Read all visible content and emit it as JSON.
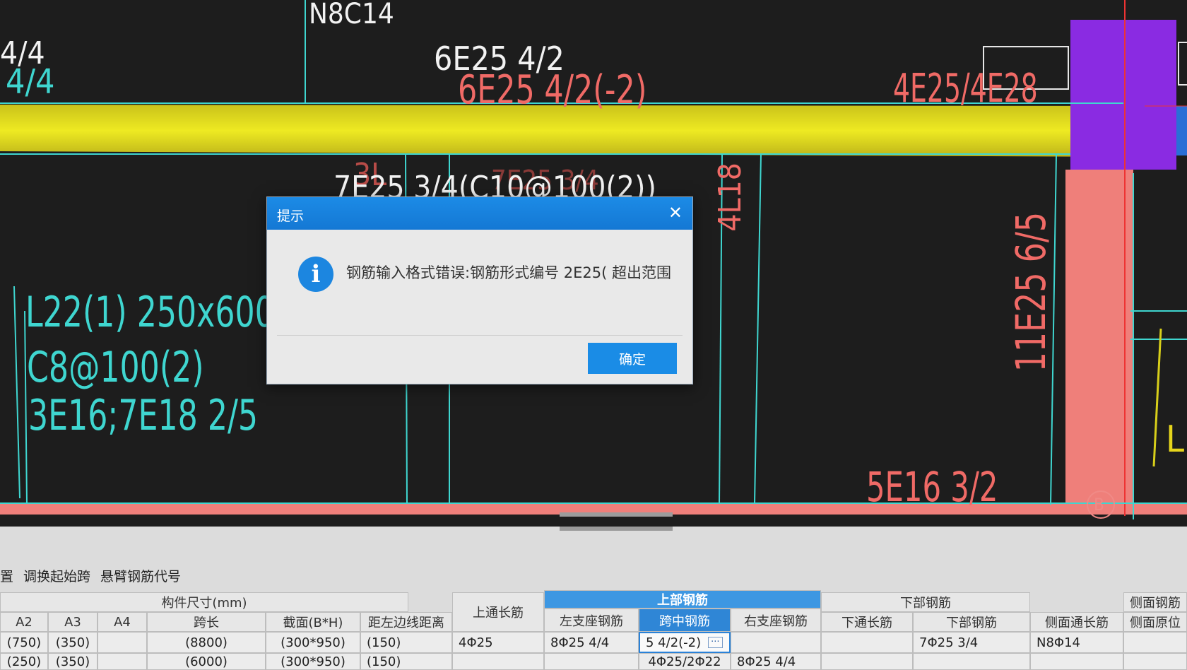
{
  "cad_labels": {
    "top_n8c14": "N8C14",
    "left_top_a": "4/4",
    "left_top_b": "4/4",
    "top_6e25": "6E25 4/2",
    "red_6e25": "6E25 4/2(-2)",
    "red_4e25": "4E25/4E28",
    "mid_7e25": "7E25 3/4(C10@100(2))",
    "ghost_7e25": "7E25 3/4",
    "ghost_31": "3L",
    "vertical_4l18": "4L18",
    "vertical_11e25": "11E25 6/5",
    "beam_line1": "L22(1) 250x600",
    "beam_line2": "C8@100(2)",
    "beam_line3": "3E16;7E18 2/5",
    "bottom_5e16": "5E16 3/2",
    "axis_b": "B",
    "right_l": "L"
  },
  "dialog": {
    "title": "提示",
    "close_glyph": "✕",
    "icon_glyph": "i",
    "message": "钢筋输入格式错误:钢筋形式编号 2E25( 超出范围",
    "ok_label": "确定"
  },
  "toolbar": {
    "cut_item": "置",
    "swap_span": "调换起始跨",
    "cantilever_code": "悬臂钢筋代号"
  },
  "table": {
    "group_size": "构件尺寸(mm)",
    "top_through": "上通长筋",
    "group_top": "上部钢筋",
    "group_bottom": "下部钢筋",
    "group_side": "侧面钢筋",
    "col_a2": "A2",
    "col_a3": "A3",
    "col_a4": "A4",
    "col_span_len": "跨长",
    "col_section": "截面(B*H)",
    "col_edge_dist": "距左边线距离",
    "col_left_support": "左支座钢筋",
    "col_mid_span": "跨中钢筋",
    "col_right_support": "右支座钢筋",
    "col_bottom_through": "下通长筋",
    "col_bottom_rebar": "下部钢筋",
    "col_side_through": "侧面通长筋",
    "col_side_orig": "侧面原位",
    "row1": {
      "a2": "(750)",
      "a3": "(350)",
      "span_len": "(8800)",
      "section": "(300*950)",
      "edge_dist": "(150)",
      "top_through": "4Φ25",
      "left_support": "8Φ25 4/4",
      "mid_span": "5 4/2(-2)",
      "bottom_rebar": "7Φ25 3/4",
      "side_through": "N8Φ14"
    },
    "row2": {
      "a2": "(250)",
      "a3": "(350)",
      "span_len": "(6000)",
      "section": "(300*950)",
      "edge_dist": "(150)",
      "mid_span": "4Φ25/2Φ22",
      "right_support": "8Φ25 4/4"
    }
  },
  "colors": {
    "cad_bg": "#1d1d1d",
    "cyan_line": "#3fd6d0",
    "red_text": "#f06a66",
    "salmon_band": "#ef7f7a",
    "yellow_band": "#e7e21d",
    "purple_block": "#8a2be2",
    "dialog_blue": "#1a8ce6"
  }
}
